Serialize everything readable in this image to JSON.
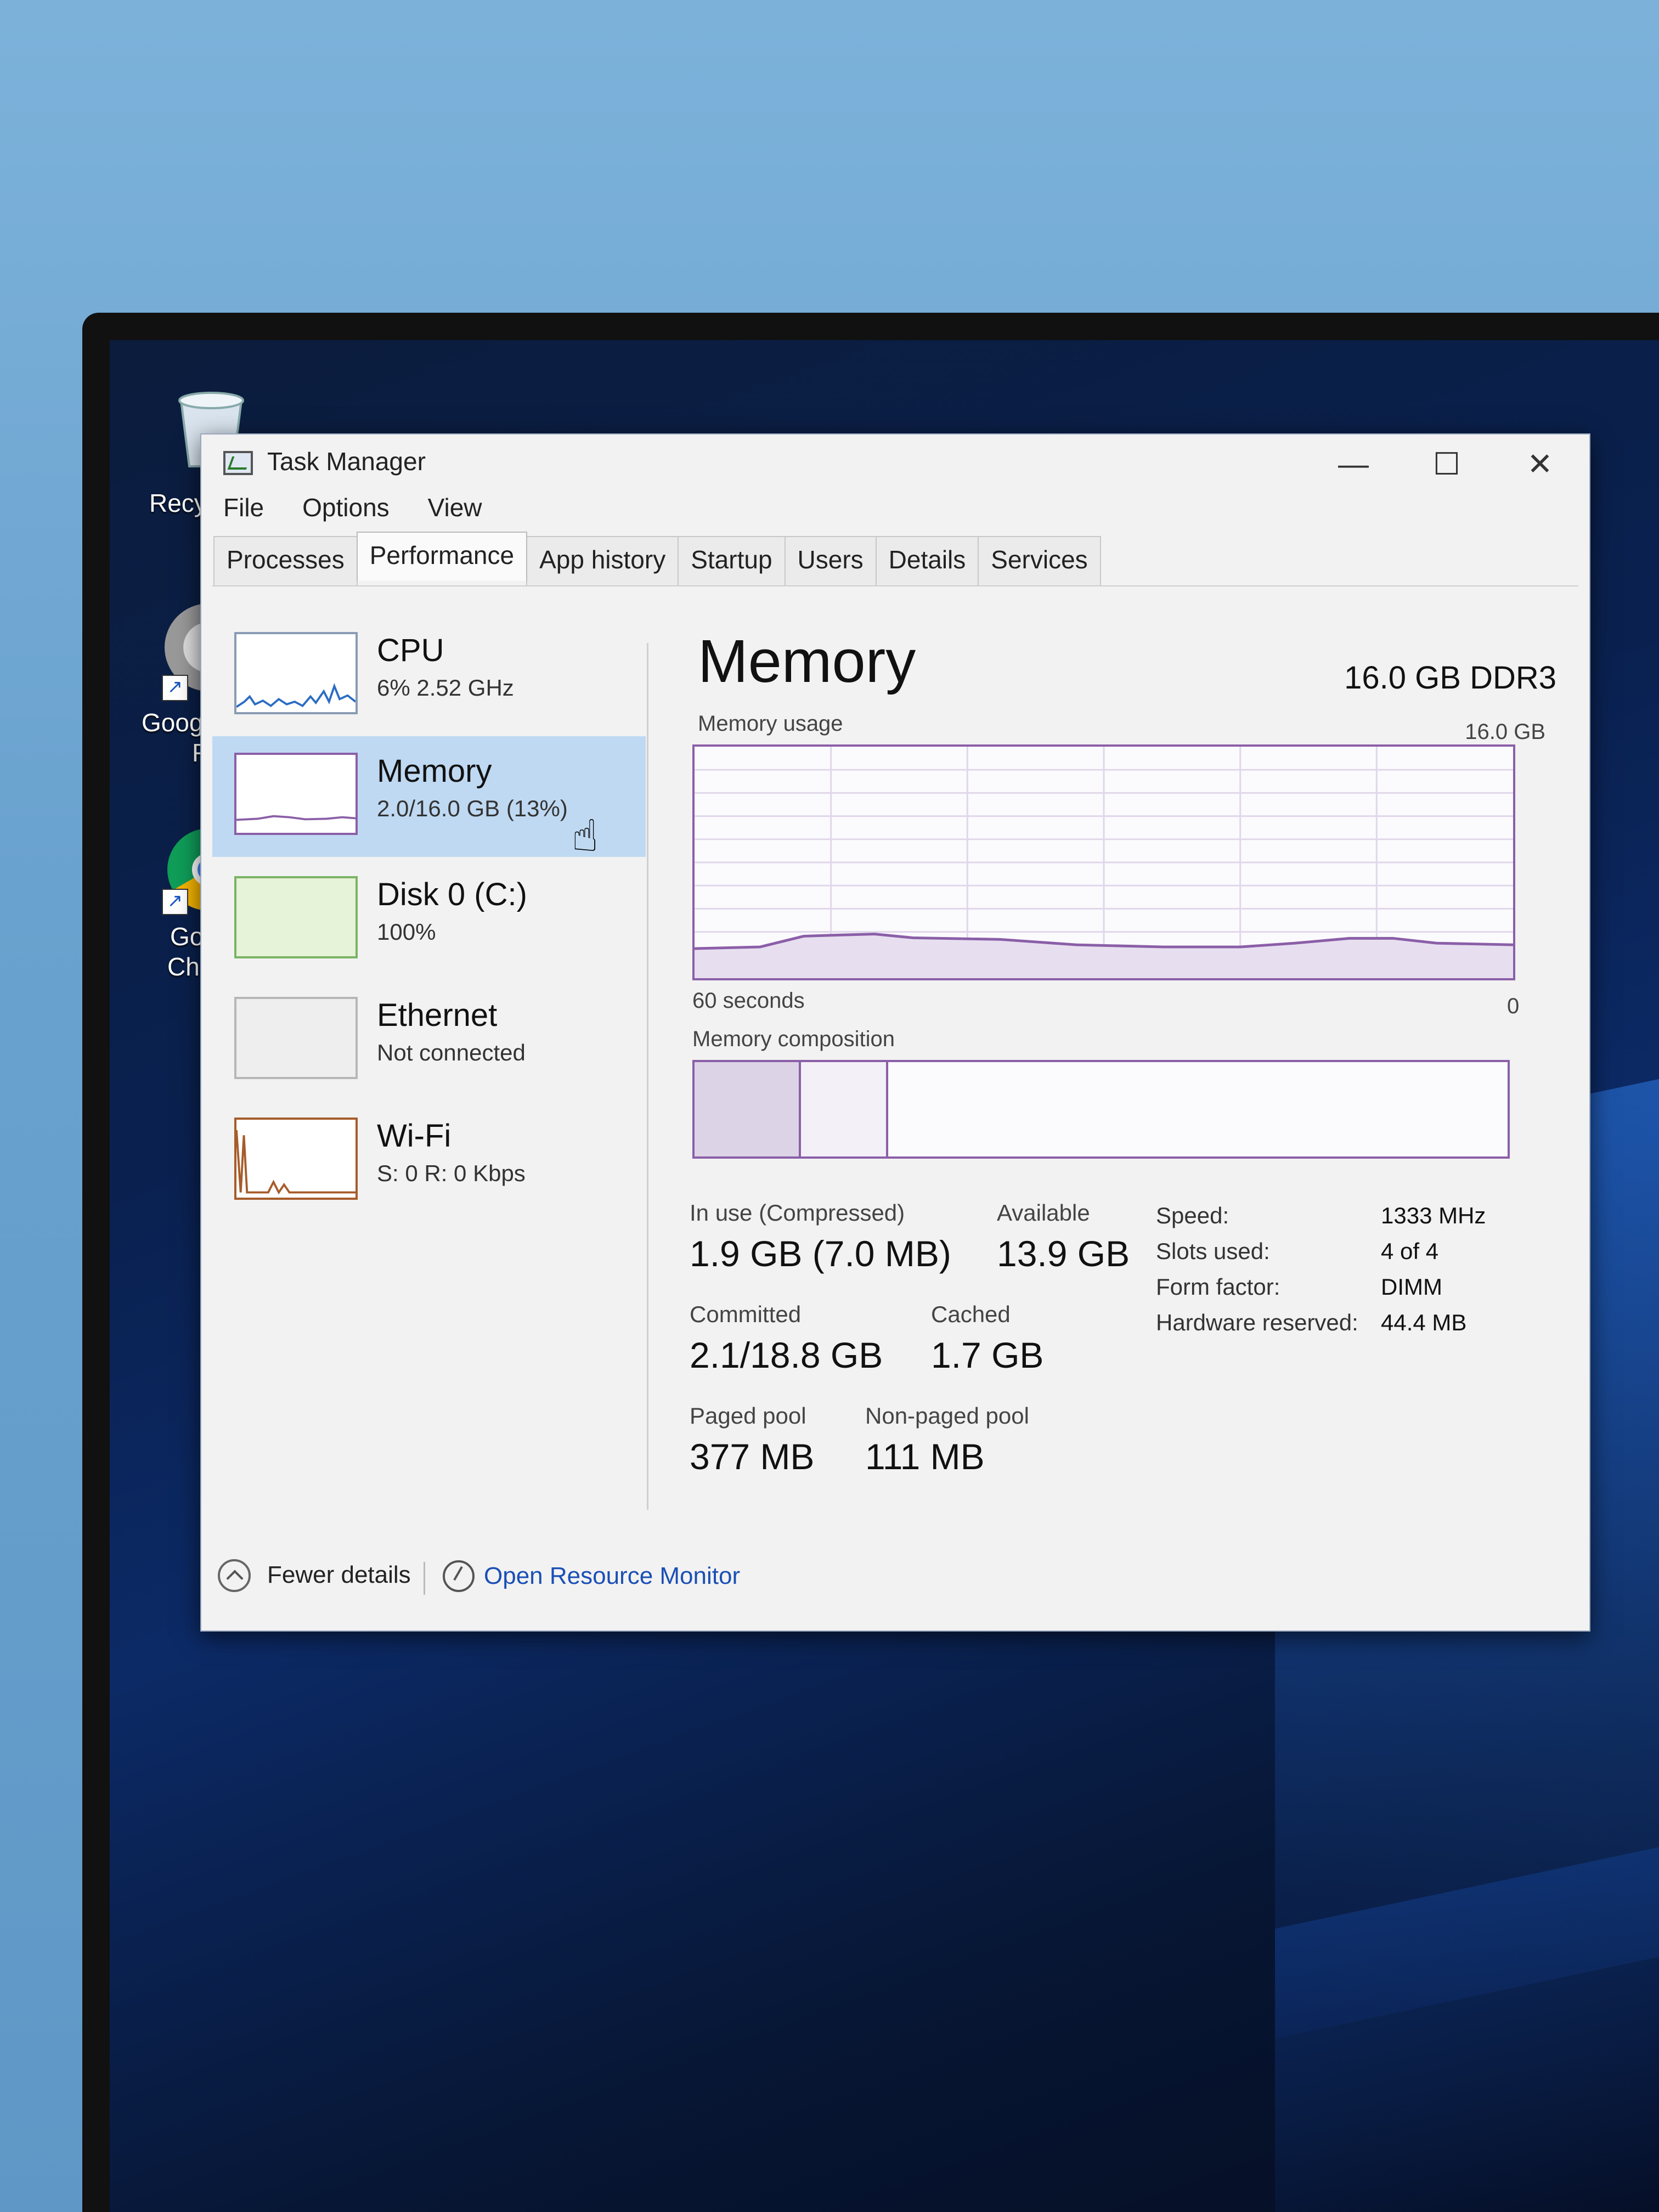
{
  "window": {
    "title": "Task Manager",
    "controls": {
      "minimize": "—",
      "maximize": "☐",
      "close": "✕"
    }
  },
  "menu": [
    "File",
    "Options",
    "View"
  ],
  "tabs": [
    {
      "label": "Processes",
      "active": false
    },
    {
      "label": "Performance",
      "active": true
    },
    {
      "label": "App history",
      "active": false
    },
    {
      "label": "Startup",
      "active": false
    },
    {
      "label": "Users",
      "active": false
    },
    {
      "label": "Details",
      "active": false
    },
    {
      "label": "Services",
      "active": false
    }
  ],
  "resources": [
    {
      "name": "CPU",
      "sub": "6% 2.52 GHz"
    },
    {
      "name": "Memory",
      "sub": "2.0/16.0 GB (13%)",
      "selected": true
    },
    {
      "name": "Disk 0 (C:)",
      "sub": "100%"
    },
    {
      "name": "Ethernet",
      "sub": "Not connected"
    },
    {
      "name": "Wi-Fi",
      "sub": "S: 0 R: 0 Kbps"
    }
  ],
  "memory": {
    "title": "Memory",
    "spec": "16.0 GB DDR3",
    "usage_label": "Memory usage",
    "usage_max": "16.0 GB",
    "time_label": "60 seconds",
    "zero_label": "0",
    "composition_label": "Memory composition",
    "usage_percent": 13,
    "stats": {
      "in_use_label": "In use (Compressed)",
      "in_use": "1.9 GB (7.0 MB)",
      "available_label": "Available",
      "available": "13.9 GB",
      "committed_label": "Committed",
      "committed": "2.1/18.8 GB",
      "cached_label": "Cached",
      "cached": "1.7 GB",
      "paged_label": "Paged pool",
      "paged": "377 MB",
      "nonpaged_label": "Non-paged pool",
      "nonpaged": "111 MB"
    },
    "specs": [
      {
        "k": "Speed:",
        "v": "1333 MHz"
      },
      {
        "k": "Slots used:",
        "v": "4 of 4"
      },
      {
        "k": "Form factor:",
        "v": "DIMM"
      },
      {
        "k": "Hardware reserved:",
        "v": "44.4 MB"
      }
    ]
  },
  "footer": {
    "fewer_details": "Fewer details",
    "open_resource_monitor": "Open Resource Monitor"
  },
  "desktop": {
    "recycle_label": "Recy",
    "google_label_1": "Goog",
    "google_label_2": "F",
    "chrome_label_1": "Go",
    "chrome_label_2": "Ch"
  },
  "colors": {
    "memory_accent": "#8b5fa8",
    "selected_bg": "#bfd9f2",
    "link": "#1a4fb5"
  }
}
